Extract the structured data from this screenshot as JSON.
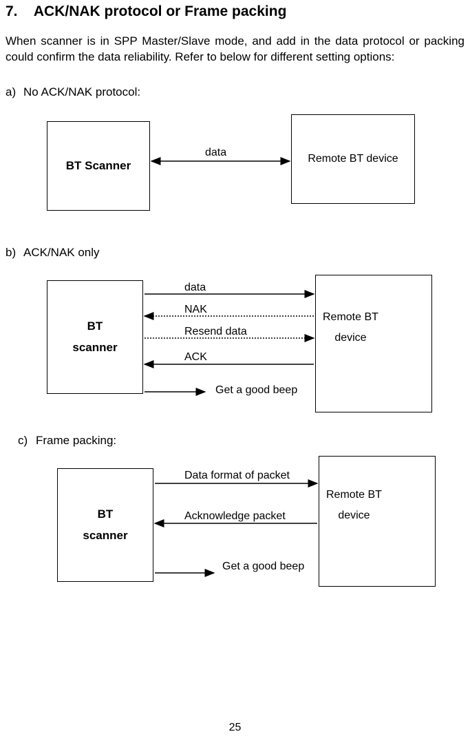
{
  "heading": {
    "number": "7.",
    "title": "ACK/NAK protocol or Frame packing"
  },
  "intro": "When scanner is in SPP Master/Slave mode, and add in the data protocol or packing could confirm the data reliability.   Refer to below for different setting options:",
  "section_a": {
    "letter": "a)",
    "title": "No ACK/NAK protocol:",
    "bt_scanner": "BT Scanner",
    "remote": "Remote BT device",
    "data": "data"
  },
  "section_b": {
    "letter": "b)",
    "title": "ACK/NAK only",
    "bt_scanner_line1": "BT",
    "bt_scanner_line2": "scanner",
    "remote_line1": "Remote BT",
    "remote_line2": "device",
    "data": "data",
    "nak": "NAK",
    "resend": "Resend data",
    "ack": "ACK",
    "beep": "Get a good beep"
  },
  "section_c": {
    "letter": "c)",
    "title": "Frame packing:",
    "bt_scanner_line1": "BT",
    "bt_scanner_line2": "scanner",
    "remote_line1": "Remote BT",
    "remote_line2": "device",
    "dataformat": "Data format of packet",
    "ackpacket": "Acknowledge packet",
    "beep": "Get a good beep"
  },
  "page_number": "25"
}
